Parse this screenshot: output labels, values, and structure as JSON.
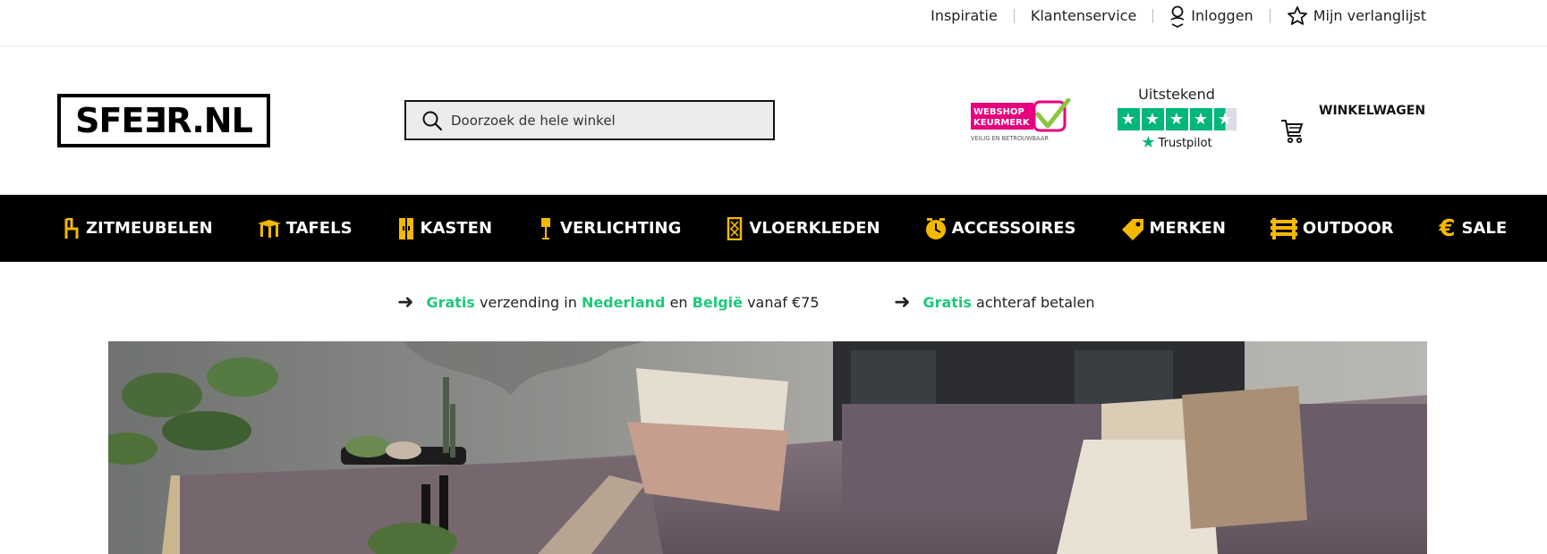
{
  "topbar": {
    "links": [
      {
        "label": "Inspiratie"
      },
      {
        "label": "Klantenservice"
      },
      {
        "label": "Inloggen",
        "icon": "user-icon"
      },
      {
        "label": "Mijn verlanglijst",
        "icon": "star-icon"
      }
    ]
  },
  "header": {
    "logo_text": "SFEƎR.NL",
    "search": {
      "placeholder": "Doorzoek de hele winkel",
      "value": ""
    },
    "keurmerk": {
      "line1": "WEBSHOP",
      "line2": "KEURMERK",
      "tagline": "VEILIG EN BETROUWBAAR"
    },
    "trustpilot": {
      "rating_label": "Uitstekend",
      "stars": 4.5,
      "brand": "Trustpilot"
    },
    "cart": {
      "label": "WINKELWAGEN",
      "icon": "cart-icon"
    }
  },
  "nav": {
    "items": [
      {
        "label": "ZITMEUBELEN",
        "icon": "chair-icon"
      },
      {
        "label": "TAFELS",
        "icon": "table-icon"
      },
      {
        "label": "KASTEN",
        "icon": "cabinet-icon"
      },
      {
        "label": "VERLICHTING",
        "icon": "lamp-icon"
      },
      {
        "label": "VLOERKLEDEN",
        "icon": "rug-icon"
      },
      {
        "label": "ACCESSOIRES",
        "icon": "clock-icon"
      },
      {
        "label": "MERKEN",
        "icon": "tag-icon"
      },
      {
        "label": "OUTDOOR",
        "icon": "bench-icon"
      },
      {
        "label": "SALE",
        "icon": "euro-icon"
      }
    ]
  },
  "usps": [
    {
      "parts": [
        "Gratis",
        " verzending in ",
        "Nederland",
        " en ",
        "België",
        " vanaf €75"
      ]
    },
    {
      "parts": [
        "Gratis",
        " achteraf betalen"
      ]
    }
  ],
  "colors": {
    "accent_green": "#1ec97a",
    "nav_bg": "#000000",
    "icon_yellow": "#f5b800",
    "trustpilot_green": "#00b67a",
    "keurmerk_pink": "#e6007e"
  }
}
